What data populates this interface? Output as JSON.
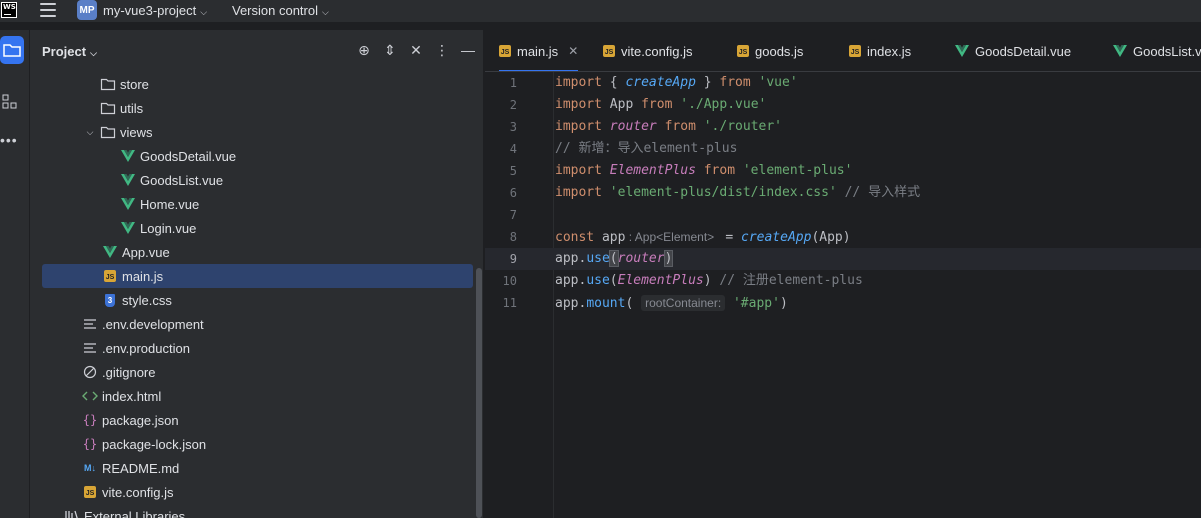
{
  "titlebar": {
    "logo_text": "WS",
    "project_badge": "MP",
    "project_name": "my-vue3-project",
    "version_control": "Version control"
  },
  "panel": {
    "title": "Project",
    "tree": [
      {
        "label": "store",
        "type": "folder",
        "expanded": false
      },
      {
        "label": "utils",
        "type": "folder",
        "expanded": false
      },
      {
        "label": "views",
        "type": "folder",
        "expanded": true
      },
      {
        "label": "GoodsDetail.vue",
        "type": "vue"
      },
      {
        "label": "GoodsList.vue",
        "type": "vue"
      },
      {
        "label": "Home.vue",
        "type": "vue"
      },
      {
        "label": "Login.vue",
        "type": "vue"
      },
      {
        "label": "App.vue",
        "type": "vue"
      },
      {
        "label": "main.js",
        "type": "js",
        "selected": true
      },
      {
        "label": "style.css",
        "type": "css"
      },
      {
        "label": ".env.development",
        "type": "text"
      },
      {
        "label": ".env.production",
        "type": "text"
      },
      {
        "label": ".gitignore",
        "type": "ignore"
      },
      {
        "label": "index.html",
        "type": "html"
      },
      {
        "label": "package.json",
        "type": "json"
      },
      {
        "label": "package-lock.json",
        "type": "json"
      },
      {
        "label": "README.md",
        "type": "md"
      },
      {
        "label": "vite.config.js",
        "type": "js"
      },
      {
        "label": "External Libraries",
        "type": "lib"
      }
    ]
  },
  "tabs": [
    {
      "label": "main.js",
      "type": "js",
      "active": true
    },
    {
      "label": "vite.config.js",
      "type": "js"
    },
    {
      "label": "goods.js",
      "type": "js"
    },
    {
      "label": "index.js",
      "type": "js"
    },
    {
      "label": "GoodsDetail.vue",
      "type": "vue"
    },
    {
      "label": "GoodsList.vue",
      "type": "vue"
    }
  ],
  "editor": {
    "current_line": 9,
    "lines": [
      {
        "n": "1",
        "tokens": [
          [
            "kw",
            "import"
          ],
          [
            "p",
            " { "
          ],
          [
            "fn-it",
            "createApp"
          ],
          [
            "p",
            " } "
          ],
          [
            "kw",
            "from"
          ],
          [
            "p",
            " "
          ],
          [
            "str",
            "'vue'"
          ]
        ]
      },
      {
        "n": "2",
        "tokens": [
          [
            "kw",
            "import"
          ],
          [
            "p",
            " App "
          ],
          [
            "kw",
            "from"
          ],
          [
            "p",
            " "
          ],
          [
            "str",
            "'./App.vue'"
          ]
        ]
      },
      {
        "n": "3",
        "tokens": [
          [
            "kw",
            "import"
          ],
          [
            "p",
            " "
          ],
          [
            "var-it",
            "router"
          ],
          [
            "p",
            " "
          ],
          [
            "kw",
            "from"
          ],
          [
            "p",
            " "
          ],
          [
            "str",
            "'./router'"
          ]
        ]
      },
      {
        "n": "4",
        "tokens": [
          [
            "comment",
            "// 新增：导入element-plus"
          ]
        ]
      },
      {
        "n": "5",
        "tokens": [
          [
            "kw",
            "import"
          ],
          [
            "p",
            " "
          ],
          [
            "var-it",
            "ElementPlus"
          ],
          [
            "p",
            " "
          ],
          [
            "kw",
            "from"
          ],
          [
            "p",
            " "
          ],
          [
            "str",
            "'element-plus'"
          ]
        ]
      },
      {
        "n": "6",
        "tokens": [
          [
            "kw",
            "import"
          ],
          [
            "p",
            " "
          ],
          [
            "str",
            "'element-plus/dist/index.css'"
          ],
          [
            "p",
            " "
          ],
          [
            "comment",
            "// 导入样式"
          ]
        ]
      },
      {
        "n": "7",
        "tokens": []
      },
      {
        "n": "8",
        "tokens": [
          [
            "kw",
            "const"
          ],
          [
            "p",
            " app"
          ],
          [
            "hint-plain",
            " : App<Element> "
          ],
          [
            "p",
            " = "
          ],
          [
            "fn-it",
            "createApp"
          ],
          [
            "p",
            "(App)"
          ]
        ]
      },
      {
        "n": "9",
        "tokens": [
          [
            "p",
            "app."
          ],
          [
            "call",
            "use"
          ],
          [
            "paren-match",
            "("
          ],
          [
            "var-it",
            "router"
          ],
          [
            "paren-match",
            ")"
          ]
        ]
      },
      {
        "n": "10",
        "tokens": [
          [
            "p",
            "app."
          ],
          [
            "call",
            "use"
          ],
          [
            "p",
            "("
          ],
          [
            "var-it",
            "ElementPlus"
          ],
          [
            "p",
            ") "
          ],
          [
            "comment",
            "// 注册element-plus"
          ]
        ]
      },
      {
        "n": "11",
        "tokens": [
          [
            "p",
            "app."
          ],
          [
            "call",
            "mount"
          ],
          [
            "p",
            "( "
          ],
          [
            "hint",
            "rootContainer:"
          ],
          [
            "p",
            " "
          ],
          [
            "str",
            "'#app'"
          ],
          [
            "p",
            ")"
          ]
        ]
      }
    ]
  }
}
